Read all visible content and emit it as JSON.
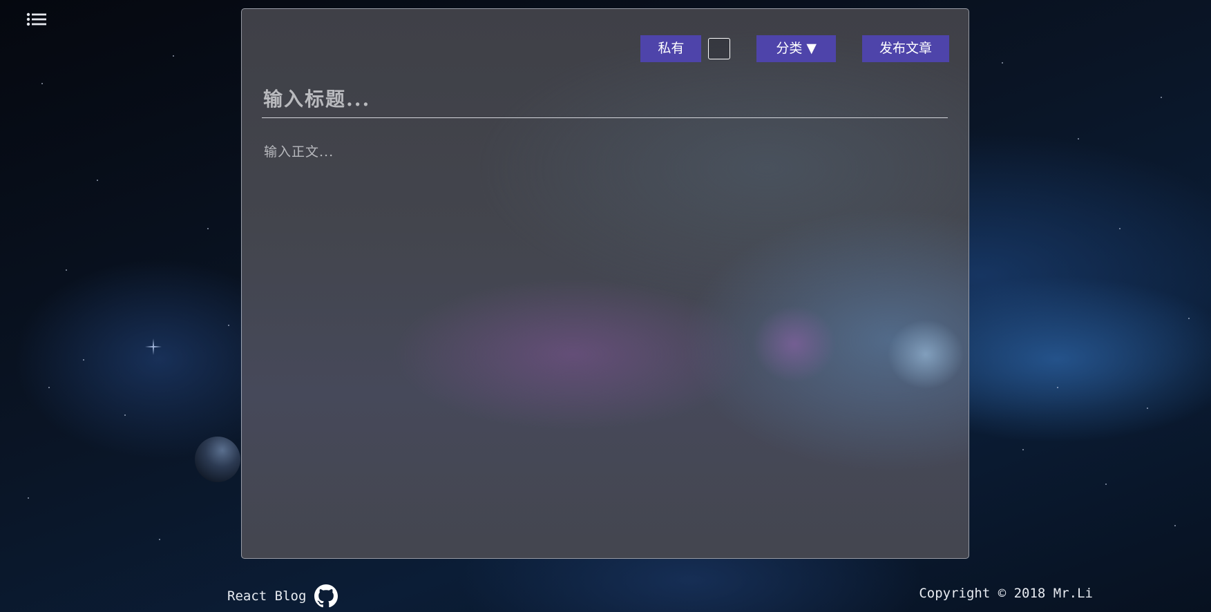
{
  "nav": {
    "menu_icon": "list-menu-icon"
  },
  "editor": {
    "private_label": "私有",
    "private_checked": false,
    "category_label": "分类 ▼",
    "publish_label": "发布文章",
    "title_placeholder": "输入标题...",
    "title_value": "",
    "body_placeholder": "输入正文...",
    "body_value": ""
  },
  "footer": {
    "brand": "React Blog",
    "brand_icon": "github-icon",
    "copyright": "Copyright © 2018 Mr.Li"
  },
  "colors": {
    "button_bg": "#4e44aa",
    "button_text": "#ffffff",
    "footer_text": "#e8ecf2"
  }
}
